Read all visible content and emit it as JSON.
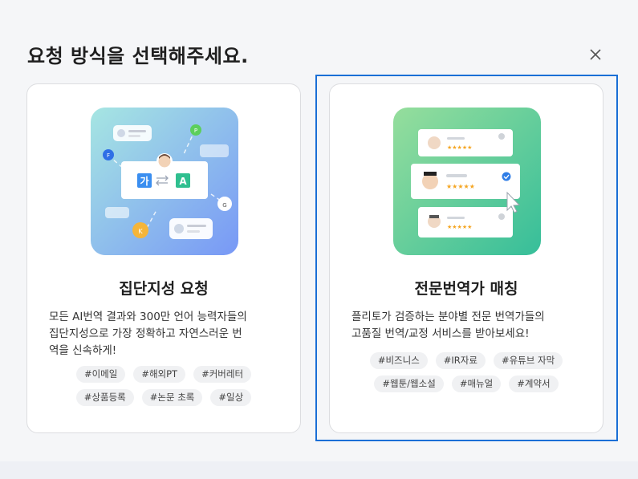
{
  "modal": {
    "title": "요청 방식을 선택해주세요."
  },
  "options": [
    {
      "title": "집단지성 요청",
      "description": "모든 AI번역 결과와 300만 언어 능력자들의\n집단지성으로 가장 정확하고 자연스러운 번\n역을 신속하게!",
      "tags": [
        "#이메일",
        "#해외PT",
        "#커버레터",
        "#상품등록",
        "#논문 초록",
        "#일상"
      ],
      "illustration": {
        "source_char": "가",
        "target_char": "A",
        "badges": [
          "F",
          "P",
          "K",
          "G"
        ]
      }
    },
    {
      "title": "전문번역가 매칭",
      "description": "플리토가 검증하는 분야별 전문 번역가들의\n고품질 번역/교정 서비스를 받아보세요!",
      "tags": [
        "#비즈니스",
        "#IR자료",
        "#유튜브 자막",
        "#웹툰/웹소설",
        "#매뉴얼",
        "#계약서"
      ],
      "illustration": {
        "rating": "★★★★★"
      },
      "selected": true
    }
  ],
  "colors": {
    "accent": "#1a6fd6",
    "star": "#f5a623",
    "crowd_gradient": [
      "#9ee0e0",
      "#7a9cf5"
    ],
    "expert_gradient": [
      "#8fdc9a",
      "#3cc198"
    ]
  },
  "icons": {
    "close": "close-icon",
    "swap": "swap-icon",
    "verified": "verified-check-icon",
    "cursor": "cursor-arrow-icon"
  }
}
